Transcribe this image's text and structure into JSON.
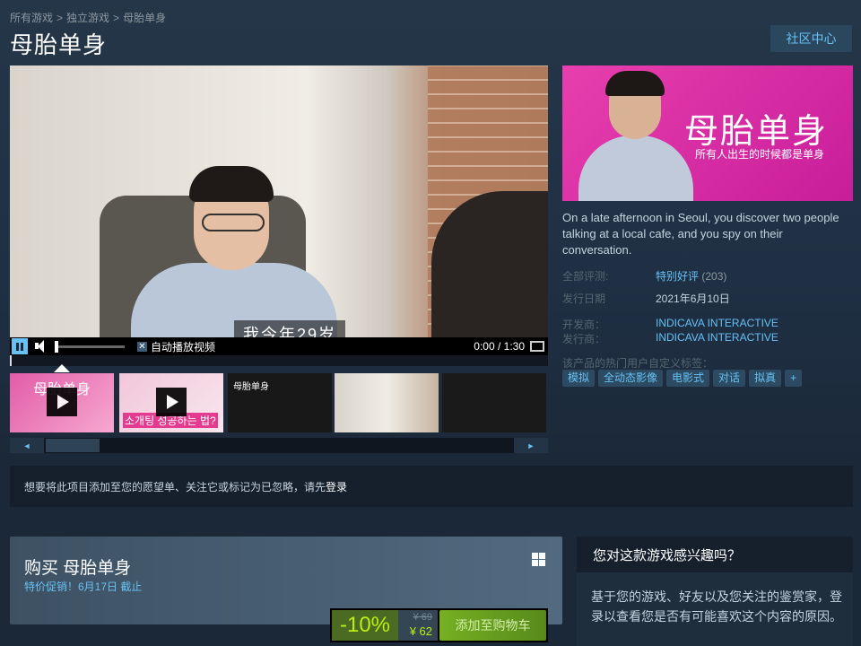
{
  "breadcrumb": [
    "所有游戏",
    "独立游戏",
    "母胎单身"
  ],
  "page_title": "母胎单身",
  "community_button": "社区中心",
  "video": {
    "subtitle": "我今年29岁",
    "autoplay_label": "自动播放视频",
    "autoplay_checked": "✕",
    "time": "0:00 / 1:30"
  },
  "thumbnails": [
    {
      "text": "母胎单身",
      "type": "video"
    },
    {
      "text": "소개팅 성공하는 법?",
      "type": "video"
    },
    {
      "text": "母胎单身",
      "type": "screenshot"
    },
    {
      "text": "",
      "type": "screenshot"
    },
    {
      "text": "",
      "type": "screenshot"
    }
  ],
  "capsule": {
    "title": "母胎单身",
    "subtitle": "所有人出生的时候都是单身"
  },
  "description": "On a late afternoon in Seoul, you discover two people talking at a local cafe, and you spy on their conversation.",
  "meta": {
    "reviews_label": "全部评测:",
    "reviews_value": "特别好评",
    "reviews_count": "(203)",
    "release_label": "发行日期",
    "release_value": "2021年6月10日",
    "developer_label": "开发商：",
    "developer_value": "INDICAVA INTERACTIVE",
    "publisher_label": "发行商：",
    "publisher_value": "INDICAVA INTERACTIVE",
    "tags_label": "该产品的热门用户自定义标签："
  },
  "tags": [
    "模拟",
    "全动态影像",
    "电影式",
    "对话",
    "拟真",
    "+"
  ],
  "login_strip": {
    "text": "想要将此项目添加至您的愿望单、关注它或标记为已忽略，请先",
    "link": "登录"
  },
  "purchase": {
    "title": "购买 母胎单身",
    "sale_note": "特价促销！6月17日 截止",
    "discount": "-10%",
    "original_price": "¥ 69",
    "final_price": "¥ 62",
    "cart_button": "添加至购物车"
  },
  "interest": {
    "title": "您对这款游戏感兴趣吗？",
    "body": "基于您的游戏、好友以及您关注的鉴赏家，登录以查看您是否有可能喜欢这个内容的原因。"
  },
  "colors": {
    "accent": "#67c1f5",
    "background": "#1b2838",
    "discount_green": "#beee11",
    "capsule_pink": "#e83fae"
  }
}
